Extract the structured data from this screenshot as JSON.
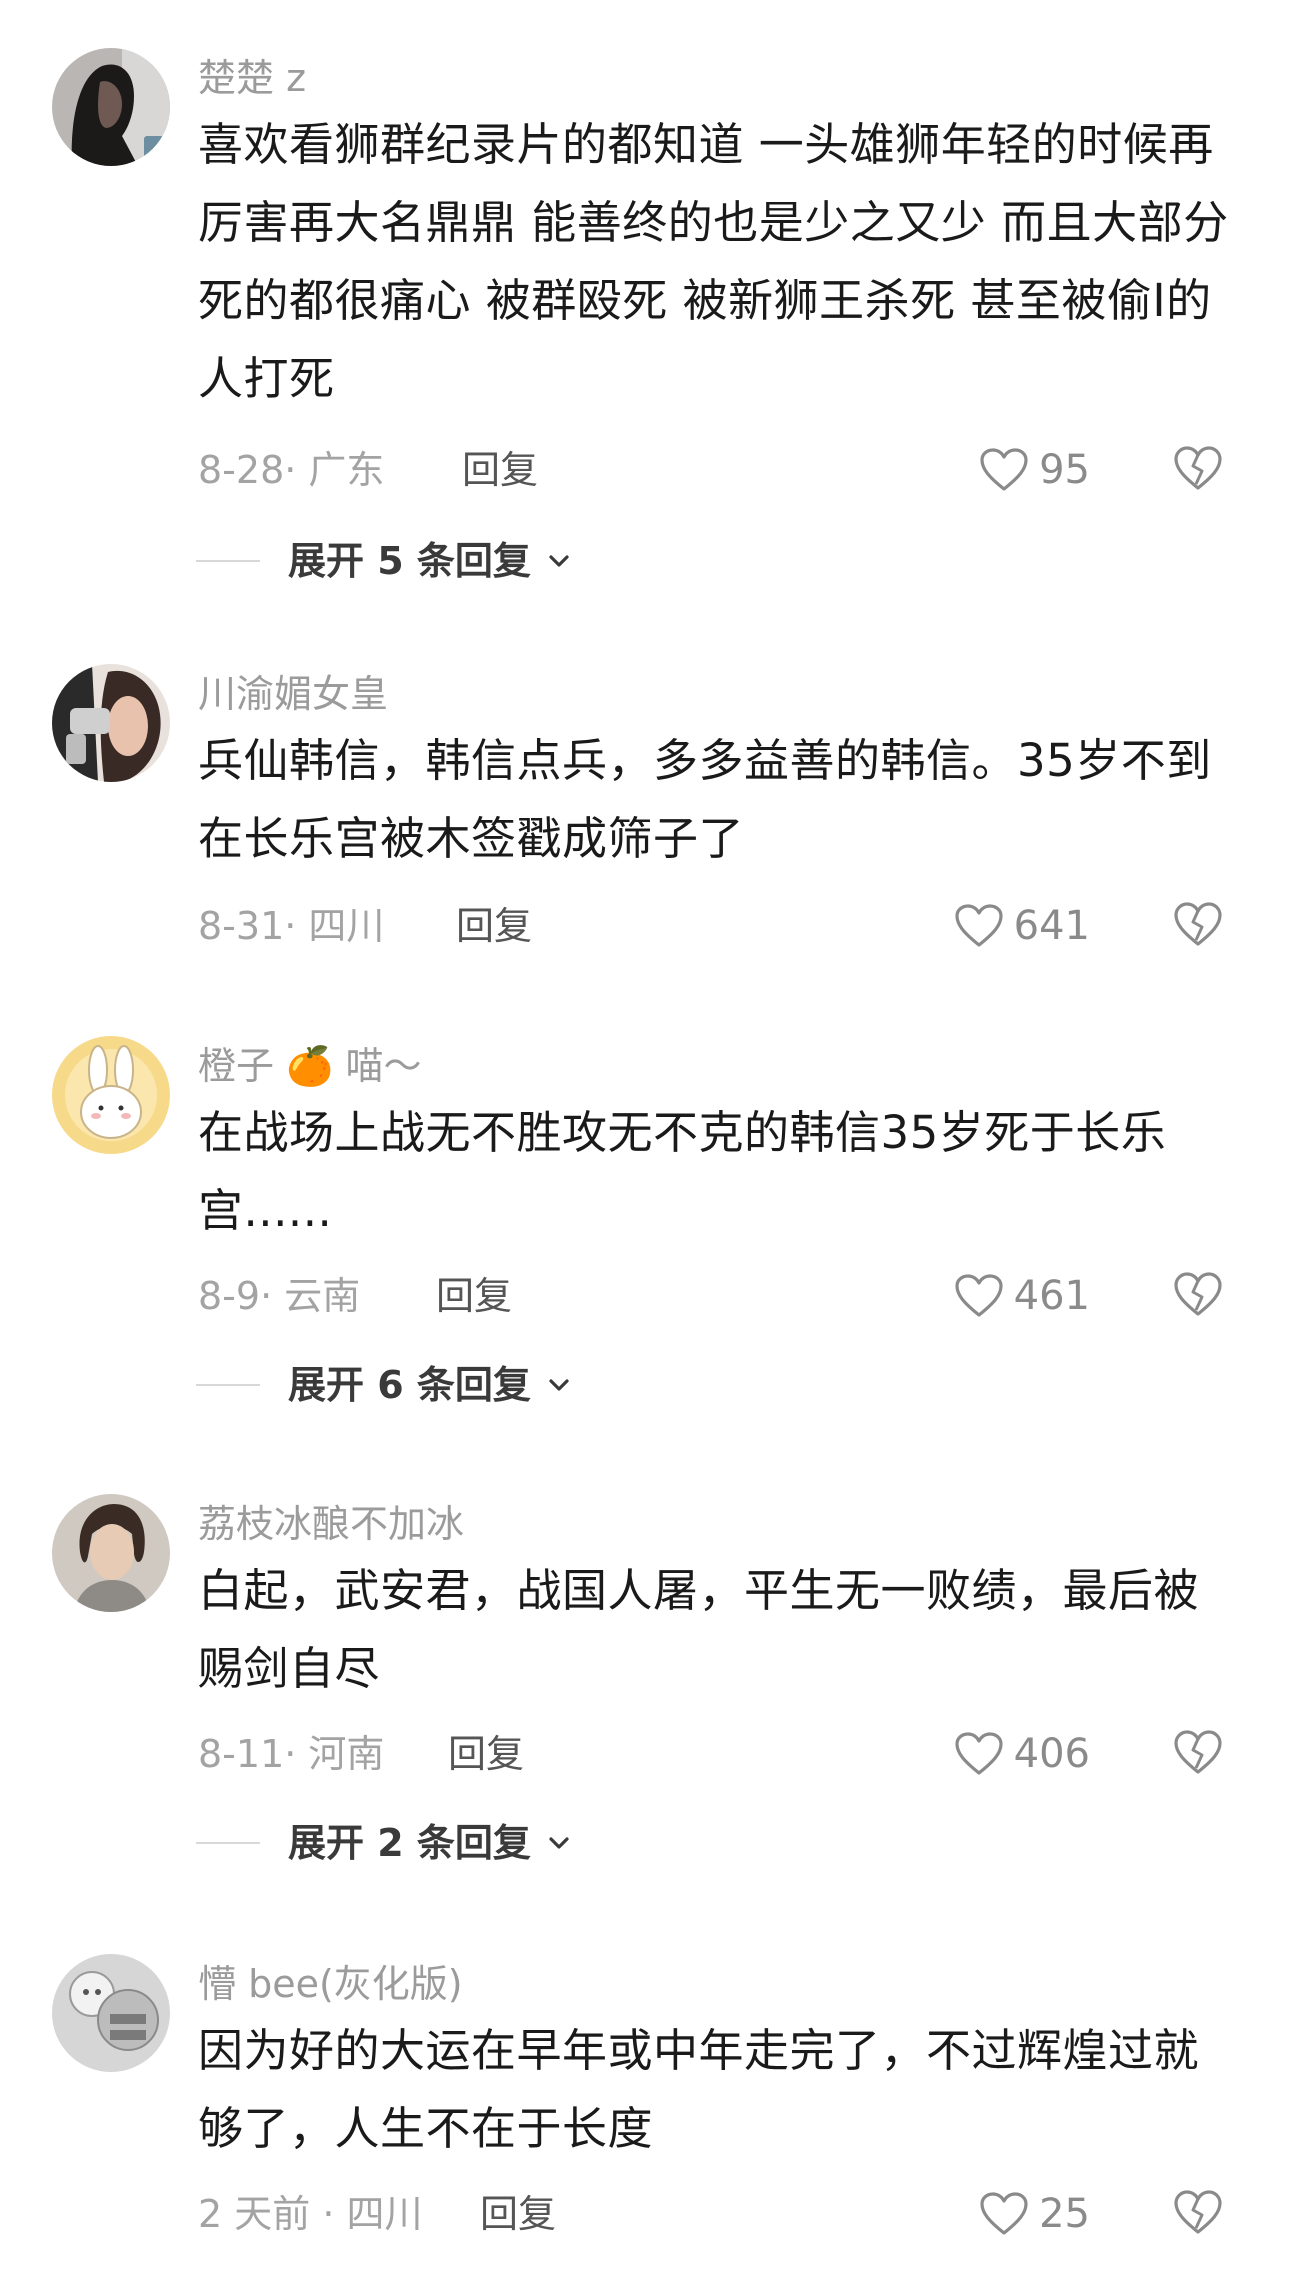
{
  "comments": [
    {
      "username": "楚楚 z",
      "text": "喜欢看狮群纪录片的都知道 一头雄狮年轻的时候再厉害再大名鼎鼎 能善终的也是少之又少 而且大部分死的都很痛心 被群殴死 被新狮王杀死 甚至被偷I的人打死",
      "meta": "8-28· 广东",
      "reply_label": "回复",
      "likes": "95",
      "like_icon": "heart-outline-icon",
      "dislike_icon": "broken-heart-icon",
      "expand_label": "展开 5 条回复",
      "avatar_icon": "woman-profile-photo"
    },
    {
      "username": "川渝媚女皇",
      "text": "兵仙韩信，韩信点兵，多多益善的韩信。35岁不到在长乐宫被木签戳成筛子了",
      "meta": "8-31· 四川",
      "reply_label": "回复",
      "likes": "641",
      "like_icon": "heart-outline-icon",
      "dislike_icon": "broken-heart-icon",
      "avatar_icon": "makeup-photo"
    },
    {
      "username": "橙子",
      "username_emoji": "🍊",
      "username_suffix": "喵～",
      "text": "在战场上战无不胜攻无不克的韩信35岁死于长乐宫......",
      "meta": "8-9· 云南",
      "reply_label": "回复",
      "likes": "461",
      "like_icon": "heart-outline-icon",
      "dislike_icon": "broken-heart-icon",
      "expand_label": "展开 6 条回复",
      "avatar_icon": "white-rabbit-cartoon"
    },
    {
      "username": "荔枝冰酿不加冰",
      "text": "白起，武安君，战国人屠，平生无一败绩，最后被赐剑自尽",
      "meta": "8-11· 河南",
      "reply_label": "回复",
      "likes": "406",
      "like_icon": "heart-outline-icon",
      "dislike_icon": "broken-heart-icon",
      "expand_label": "展开 2 条回复",
      "avatar_icon": "portrait-photo"
    },
    {
      "username": "懵 bee(灰化版)",
      "text": "因为好的大运在早年或中年走完了，不过辉煌过就够了，人生不在于长度",
      "meta": "2 天前 · 四川",
      "reply_label": "回复",
      "likes": "25",
      "like_icon": "heart-outline-icon",
      "dislike_icon": "broken-heart-icon",
      "avatar_icon": "gray-cartoon-avatar"
    }
  ],
  "colors": {
    "text_primary": "#1a1a1a",
    "text_secondary": "#9b9b9b",
    "background": "#ffffff"
  }
}
